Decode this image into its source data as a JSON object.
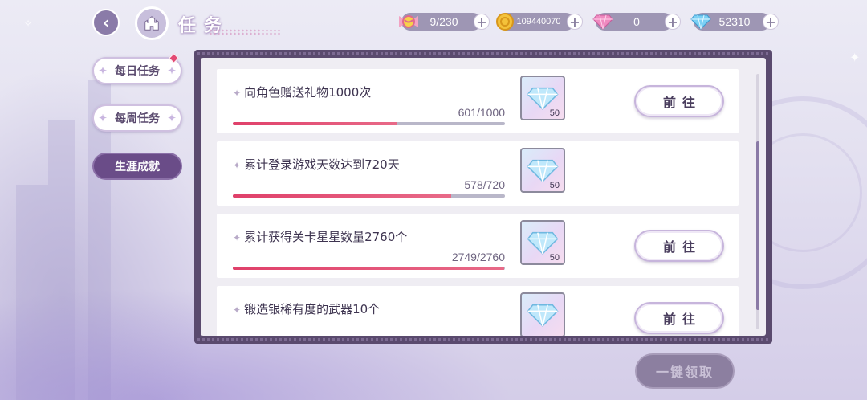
{
  "header": {
    "title": "任务"
  },
  "currencies": [
    {
      "icon": "candy-icon",
      "value": "9/230"
    },
    {
      "icon": "gold-coin-icon",
      "value": "109440070"
    },
    {
      "icon": "pink-diamond-icon",
      "value": "0"
    },
    {
      "icon": "blue-diamond-icon",
      "value": "52310"
    }
  ],
  "tabs": [
    {
      "label": "每日任务",
      "active": false,
      "badge": true
    },
    {
      "label": "每周任务",
      "active": false,
      "badge": false
    },
    {
      "label": "生涯成就",
      "active": true,
      "badge": false
    }
  ],
  "tasks": [
    {
      "name": "向角色赠送礼物1000次",
      "progress": "601/1000",
      "fraction": 0.601,
      "reward_qty": "50",
      "button": "前往"
    },
    {
      "name": "累计登录游戏天数达到720天",
      "progress": "578/720",
      "fraction": 0.803,
      "reward_qty": "50",
      "button": ""
    },
    {
      "name": "累计获得关卡星星数量2760个",
      "progress": "2749/2760",
      "fraction": 0.996,
      "reward_qty": "50",
      "button": "前往"
    },
    {
      "name": "锻造银稀有度的武器10个",
      "progress": "",
      "fraction": 0,
      "reward_qty": "",
      "button": "前往"
    }
  ],
  "claim_all_label": "一键领取",
  "colors": {
    "panel_border": "#5a4a6e",
    "progress_fill": "#e0406a",
    "active_tab": "#6a4c88"
  }
}
